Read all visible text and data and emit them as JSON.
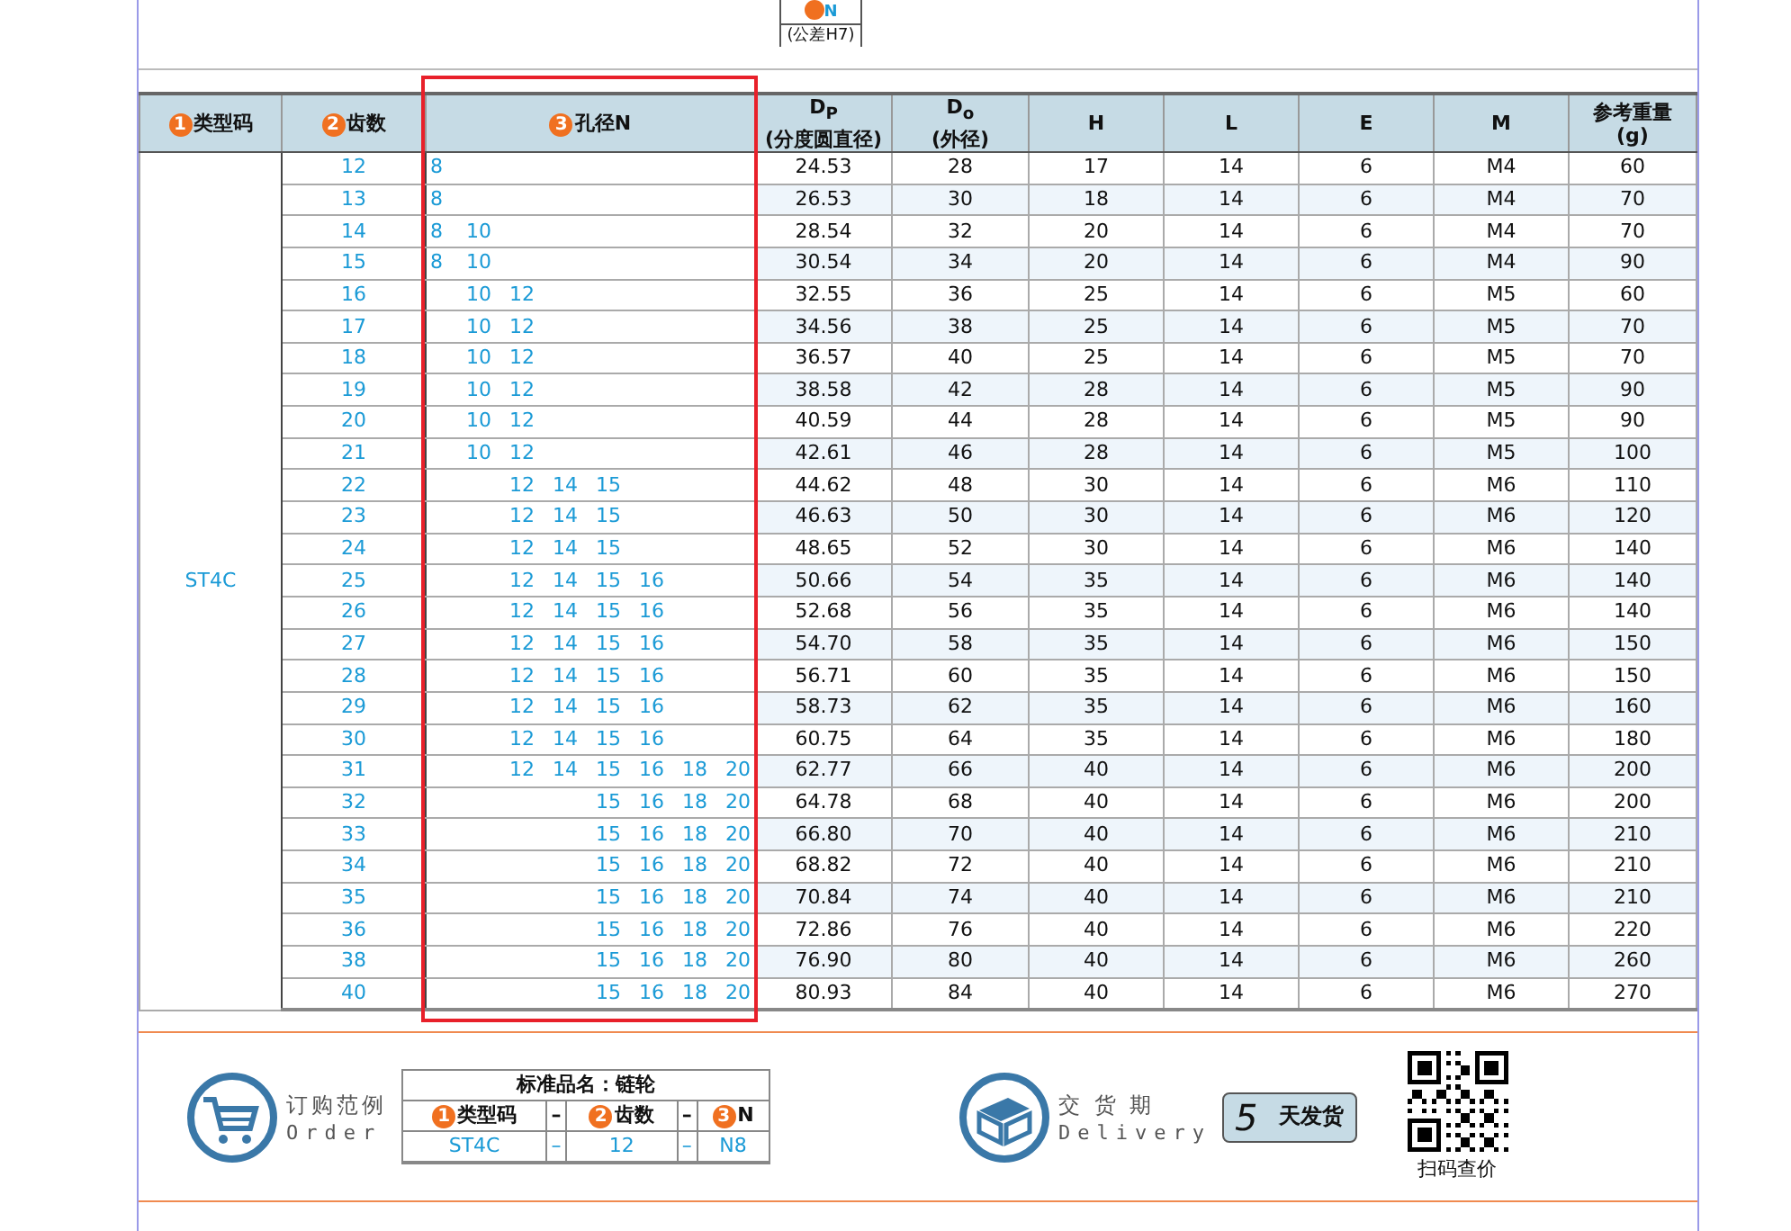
{
  "dimension_note": {
    "label": "N",
    "tolerance": "(公差H7)"
  },
  "table": {
    "columns": [
      {
        "badge": "1",
        "label": "类型码"
      },
      {
        "badge": "2",
        "label": "齿数"
      },
      {
        "badge": "3",
        "label": "孔径N"
      },
      {
        "label": "D$_{P}$",
        "sub": "(分度圆直径)"
      },
      {
        "label": "D$_{o}$",
        "sub": "(外径)"
      },
      {
        "label": "H"
      },
      {
        "label": "L"
      },
      {
        "label": "E"
      },
      {
        "label": "M"
      },
      {
        "label": "参考重量",
        "sub": "(g)"
      }
    ],
    "type_code": "ST4C",
    "rows": [
      {
        "teeth": "12",
        "bores": [
          "8"
        ],
        "dp": "24.53",
        "do": "28",
        "h": "17",
        "l": "14",
        "e": "6",
        "m": "M4",
        "weight": "60"
      },
      {
        "teeth": "13",
        "bores": [
          "8"
        ],
        "dp": "26.53",
        "do": "30",
        "h": "18",
        "l": "14",
        "e": "6",
        "m": "M4",
        "weight": "70"
      },
      {
        "teeth": "14",
        "bores": [
          "8",
          "10"
        ],
        "dp": "28.54",
        "do": "32",
        "h": "20",
        "l": "14",
        "e": "6",
        "m": "M4",
        "weight": "70"
      },
      {
        "teeth": "15",
        "bores": [
          "8",
          "10"
        ],
        "dp": "30.54",
        "do": "34",
        "h": "20",
        "l": "14",
        "e": "6",
        "m": "M4",
        "weight": "90"
      },
      {
        "teeth": "16",
        "bores": [
          "10",
          "12"
        ],
        "dp": "32.55",
        "do": "36",
        "h": "25",
        "l": "14",
        "e": "6",
        "m": "M5",
        "weight": "60"
      },
      {
        "teeth": "17",
        "bores": [
          "10",
          "12"
        ],
        "dp": "34.56",
        "do": "38",
        "h": "25",
        "l": "14",
        "e": "6",
        "m": "M5",
        "weight": "70"
      },
      {
        "teeth": "18",
        "bores": [
          "10",
          "12"
        ],
        "dp": "36.57",
        "do": "40",
        "h": "25",
        "l": "14",
        "e": "6",
        "m": "M5",
        "weight": "70"
      },
      {
        "teeth": "19",
        "bores": [
          "10",
          "12"
        ],
        "dp": "38.58",
        "do": "42",
        "h": "28",
        "l": "14",
        "e": "6",
        "m": "M5",
        "weight": "90"
      },
      {
        "teeth": "20",
        "bores": [
          "10",
          "12"
        ],
        "dp": "40.59",
        "do": "44",
        "h": "28",
        "l": "14",
        "e": "6",
        "m": "M5",
        "weight": "90"
      },
      {
        "teeth": "21",
        "bores": [
          "10",
          "12"
        ],
        "dp": "42.61",
        "do": "46",
        "h": "28",
        "l": "14",
        "e": "6",
        "m": "M5",
        "weight": "100"
      },
      {
        "teeth": "22",
        "bores": [
          "12",
          "14",
          "15"
        ],
        "dp": "44.62",
        "do": "48",
        "h": "30",
        "l": "14",
        "e": "6",
        "m": "M6",
        "weight": "110"
      },
      {
        "teeth": "23",
        "bores": [
          "12",
          "14",
          "15"
        ],
        "dp": "46.63",
        "do": "50",
        "h": "30",
        "l": "14",
        "e": "6",
        "m": "M6",
        "weight": "120"
      },
      {
        "teeth": "24",
        "bores": [
          "12",
          "14",
          "15"
        ],
        "dp": "48.65",
        "do": "52",
        "h": "30",
        "l": "14",
        "e": "6",
        "m": "M6",
        "weight": "140"
      },
      {
        "teeth": "25",
        "bores": [
          "12",
          "14",
          "15",
          "16"
        ],
        "dp": "50.66",
        "do": "54",
        "h": "35",
        "l": "14",
        "e": "6",
        "m": "M6",
        "weight": "140"
      },
      {
        "teeth": "26",
        "bores": [
          "12",
          "14",
          "15",
          "16"
        ],
        "dp": "52.68",
        "do": "56",
        "h": "35",
        "l": "14",
        "e": "6",
        "m": "M6",
        "weight": "140"
      },
      {
        "teeth": "27",
        "bores": [
          "12",
          "14",
          "15",
          "16"
        ],
        "dp": "54.70",
        "do": "58",
        "h": "35",
        "l": "14",
        "e": "6",
        "m": "M6",
        "weight": "150"
      },
      {
        "teeth": "28",
        "bores": [
          "12",
          "14",
          "15",
          "16"
        ],
        "dp": "56.71",
        "do": "60",
        "h": "35",
        "l": "14",
        "e": "6",
        "m": "M6",
        "weight": "150"
      },
      {
        "teeth": "29",
        "bores": [
          "12",
          "14",
          "15",
          "16"
        ],
        "dp": "58.73",
        "do": "62",
        "h": "35",
        "l": "14",
        "e": "6",
        "m": "M6",
        "weight": "160"
      },
      {
        "teeth": "30",
        "bores": [
          "12",
          "14",
          "15",
          "16"
        ],
        "dp": "60.75",
        "do": "64",
        "h": "35",
        "l": "14",
        "e": "6",
        "m": "M6",
        "weight": "180"
      },
      {
        "teeth": "31",
        "bores": [
          "12",
          "14",
          "15",
          "16",
          "18",
          "20"
        ],
        "dp": "62.77",
        "do": "66",
        "h": "40",
        "l": "14",
        "e": "6",
        "m": "M6",
        "weight": "200"
      },
      {
        "teeth": "32",
        "bores": [
          "15",
          "16",
          "18",
          "20"
        ],
        "dp": "64.78",
        "do": "68",
        "h": "40",
        "l": "14",
        "e": "6",
        "m": "M6",
        "weight": "200"
      },
      {
        "teeth": "33",
        "bores": [
          "15",
          "16",
          "18",
          "20"
        ],
        "dp": "66.80",
        "do": "70",
        "h": "40",
        "l": "14",
        "e": "6",
        "m": "M6",
        "weight": "210"
      },
      {
        "teeth": "34",
        "bores": [
          "15",
          "16",
          "18",
          "20"
        ],
        "dp": "68.82",
        "do": "72",
        "h": "40",
        "l": "14",
        "e": "6",
        "m": "M6",
        "weight": "210"
      },
      {
        "teeth": "35",
        "bores": [
          "15",
          "16",
          "18",
          "20"
        ],
        "dp": "70.84",
        "do": "74",
        "h": "40",
        "l": "14",
        "e": "6",
        "m": "M6",
        "weight": "210"
      },
      {
        "teeth": "36",
        "bores": [
          "15",
          "16",
          "18",
          "20"
        ],
        "dp": "72.86",
        "do": "76",
        "h": "40",
        "l": "14",
        "e": "6",
        "m": "M6",
        "weight": "220"
      },
      {
        "teeth": "38",
        "bores": [
          "15",
          "16",
          "18",
          "20"
        ],
        "dp": "76.90",
        "do": "80",
        "h": "40",
        "l": "14",
        "e": "6",
        "m": "M6",
        "weight": "260"
      },
      {
        "teeth": "40",
        "bores": [
          "15",
          "16",
          "18",
          "20"
        ],
        "dp": "80.93",
        "do": "84",
        "h": "40",
        "l": "14",
        "e": "6",
        "m": "M6",
        "weight": "270"
      }
    ]
  },
  "order_example": {
    "title_cn": "订购范例",
    "title_en": "Order",
    "caption": "标准品名：链轮",
    "headers": [
      {
        "badge": "1",
        "label": "类型码"
      },
      {
        "label": "–"
      },
      {
        "badge": "2",
        "label": "齿数"
      },
      {
        "label": "–"
      },
      {
        "badge": "3",
        "label": "N"
      }
    ],
    "values": [
      "ST4C",
      "–",
      "12",
      "–",
      "N8"
    ]
  },
  "delivery": {
    "title_cn": "交 货 期",
    "title_en": "Delivery",
    "days": "5",
    "unit": "天发货"
  },
  "qr": {
    "caption": "扫码查价"
  }
}
